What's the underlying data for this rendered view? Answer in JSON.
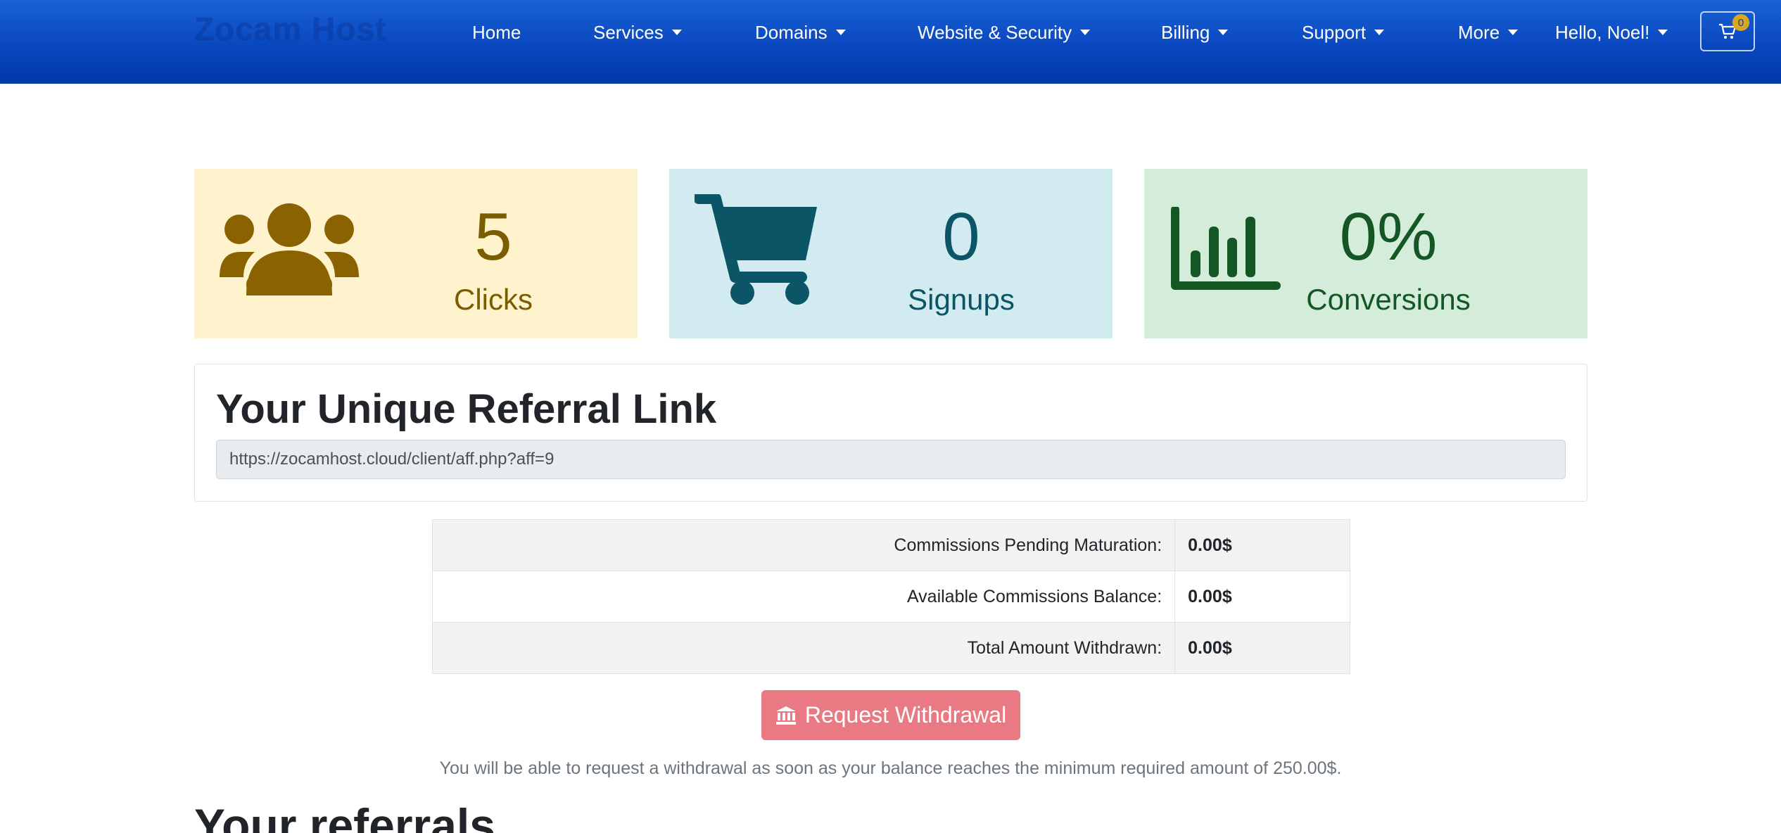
{
  "navbar": {
    "brand": "Zocam Host",
    "items": [
      {
        "label": "Home",
        "dropdown": false
      },
      {
        "label": "Services",
        "dropdown": true
      },
      {
        "label": "Domains",
        "dropdown": true
      },
      {
        "label": "Website & Security",
        "dropdown": true
      },
      {
        "label": "Billing",
        "dropdown": true
      },
      {
        "label": "Support",
        "dropdown": true
      },
      {
        "label": "More",
        "dropdown": true
      },
      {
        "label": "Hello, Noel!",
        "dropdown": true
      }
    ],
    "cart_count": "0"
  },
  "stats": {
    "clicks": {
      "value": "5",
      "label": "Clicks",
      "icon": "users-icon"
    },
    "signups": {
      "value": "0",
      "label": "Signups",
      "icon": "cart-icon"
    },
    "conversions": {
      "value": "0%",
      "label": "Conversions",
      "icon": "bar-chart-icon"
    }
  },
  "referral": {
    "title": "Your Unique Referral Link",
    "link": "https://zocamhost.cloud/client/aff.php?aff=9"
  },
  "commissions": [
    {
      "label": "Commissions Pending Maturation:",
      "value": "0.00$"
    },
    {
      "label": "Available Commissions Balance:",
      "value": "0.00$"
    },
    {
      "label": "Total Amount Withdrawn:",
      "value": "0.00$"
    }
  ],
  "withdraw": {
    "button_label": "Request Withdrawal",
    "note": "You will be able to request a withdrawal as soon as your balance reaches the minimum required amount of 250.00$."
  },
  "referrals_section": {
    "title": "Your referrals"
  },
  "colors": {
    "navbar": "#0a47bf",
    "clicks_bg": "#fff3cd",
    "signups_bg": "#d1ebf0",
    "conversions_bg": "#d4edda",
    "withdraw_button": "#e97a83"
  }
}
